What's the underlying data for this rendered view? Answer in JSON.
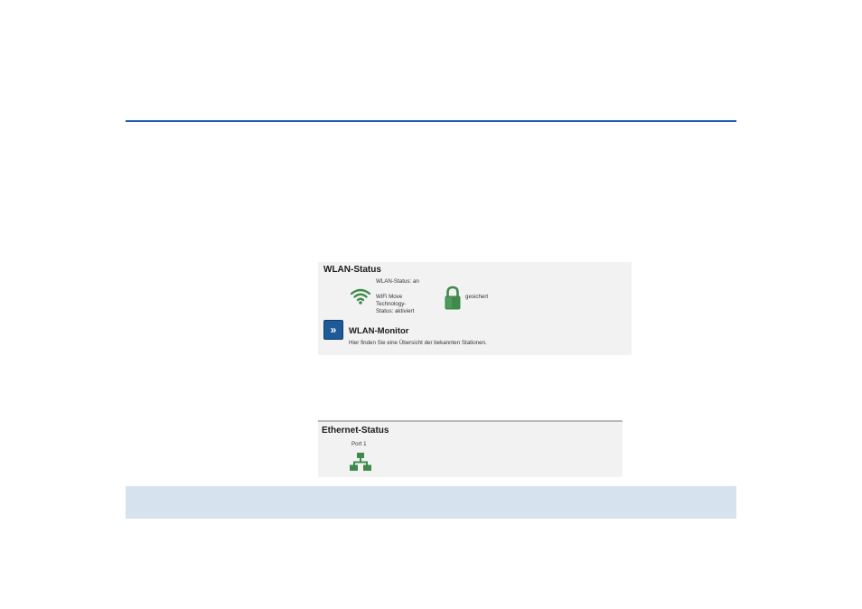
{
  "wlan": {
    "title": "WLAN-Status",
    "status_line": "WLAN-Status: an",
    "wifi_move_line1": "WiFi Move",
    "wifi_move_line2": "Technology-",
    "wifi_move_line3": "Status: aktiviert",
    "security_label": "gesichert",
    "monitor_button_glyph": "»",
    "monitor_title": "WLAN-Monitor",
    "monitor_description": "Hier finden Sie eine Übersicht der bekannten Stationen."
  },
  "ethernet": {
    "title": "Ethernet-Status",
    "port_label": "Port 1"
  },
  "colors": {
    "accent_rule": "#1f5fae",
    "icon_green": "#3f8a4a",
    "button_blue": "#1d5a97",
    "footer_bar": "#d6e3ee"
  },
  "icons": {
    "wifi": "wifi-icon",
    "lock": "lock-icon",
    "monitor": "chevron-double-right-icon",
    "network": "network-icon"
  }
}
